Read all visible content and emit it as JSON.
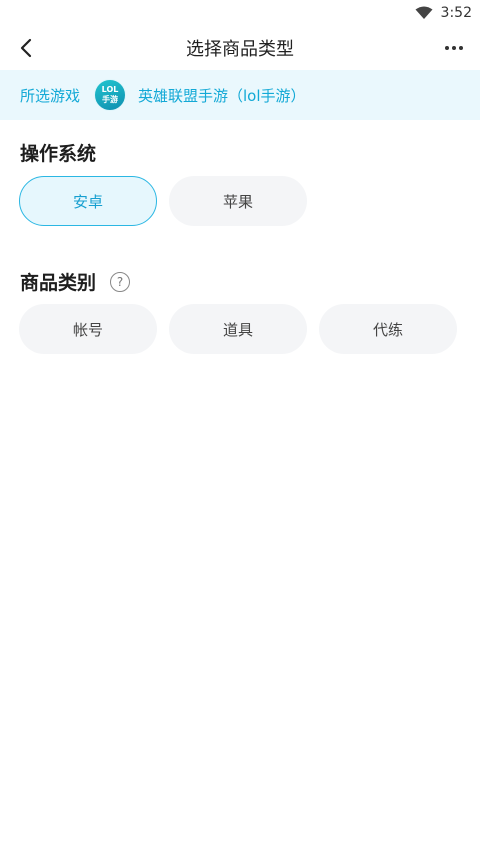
{
  "status_bar": {
    "time": "3:52"
  },
  "nav": {
    "title": "选择商品类型"
  },
  "game": {
    "label": "所选游戏",
    "logo_top": "LOL",
    "logo_bottom": "手游",
    "name": "英雄联盟手游（lol手游）"
  },
  "os_section": {
    "title": "操作系统",
    "options": [
      {
        "label": "安卓",
        "selected": true
      },
      {
        "label": "苹果",
        "selected": false
      }
    ]
  },
  "category_section": {
    "title": "商品类别",
    "help_glyph": "?",
    "options": [
      {
        "label": "帐号"
      },
      {
        "label": "道具"
      },
      {
        "label": "代练"
      }
    ]
  },
  "colors": {
    "accent": "#2bb7e3",
    "banner_bg": "#eaf8fd",
    "chip_bg": "#f4f5f7"
  }
}
